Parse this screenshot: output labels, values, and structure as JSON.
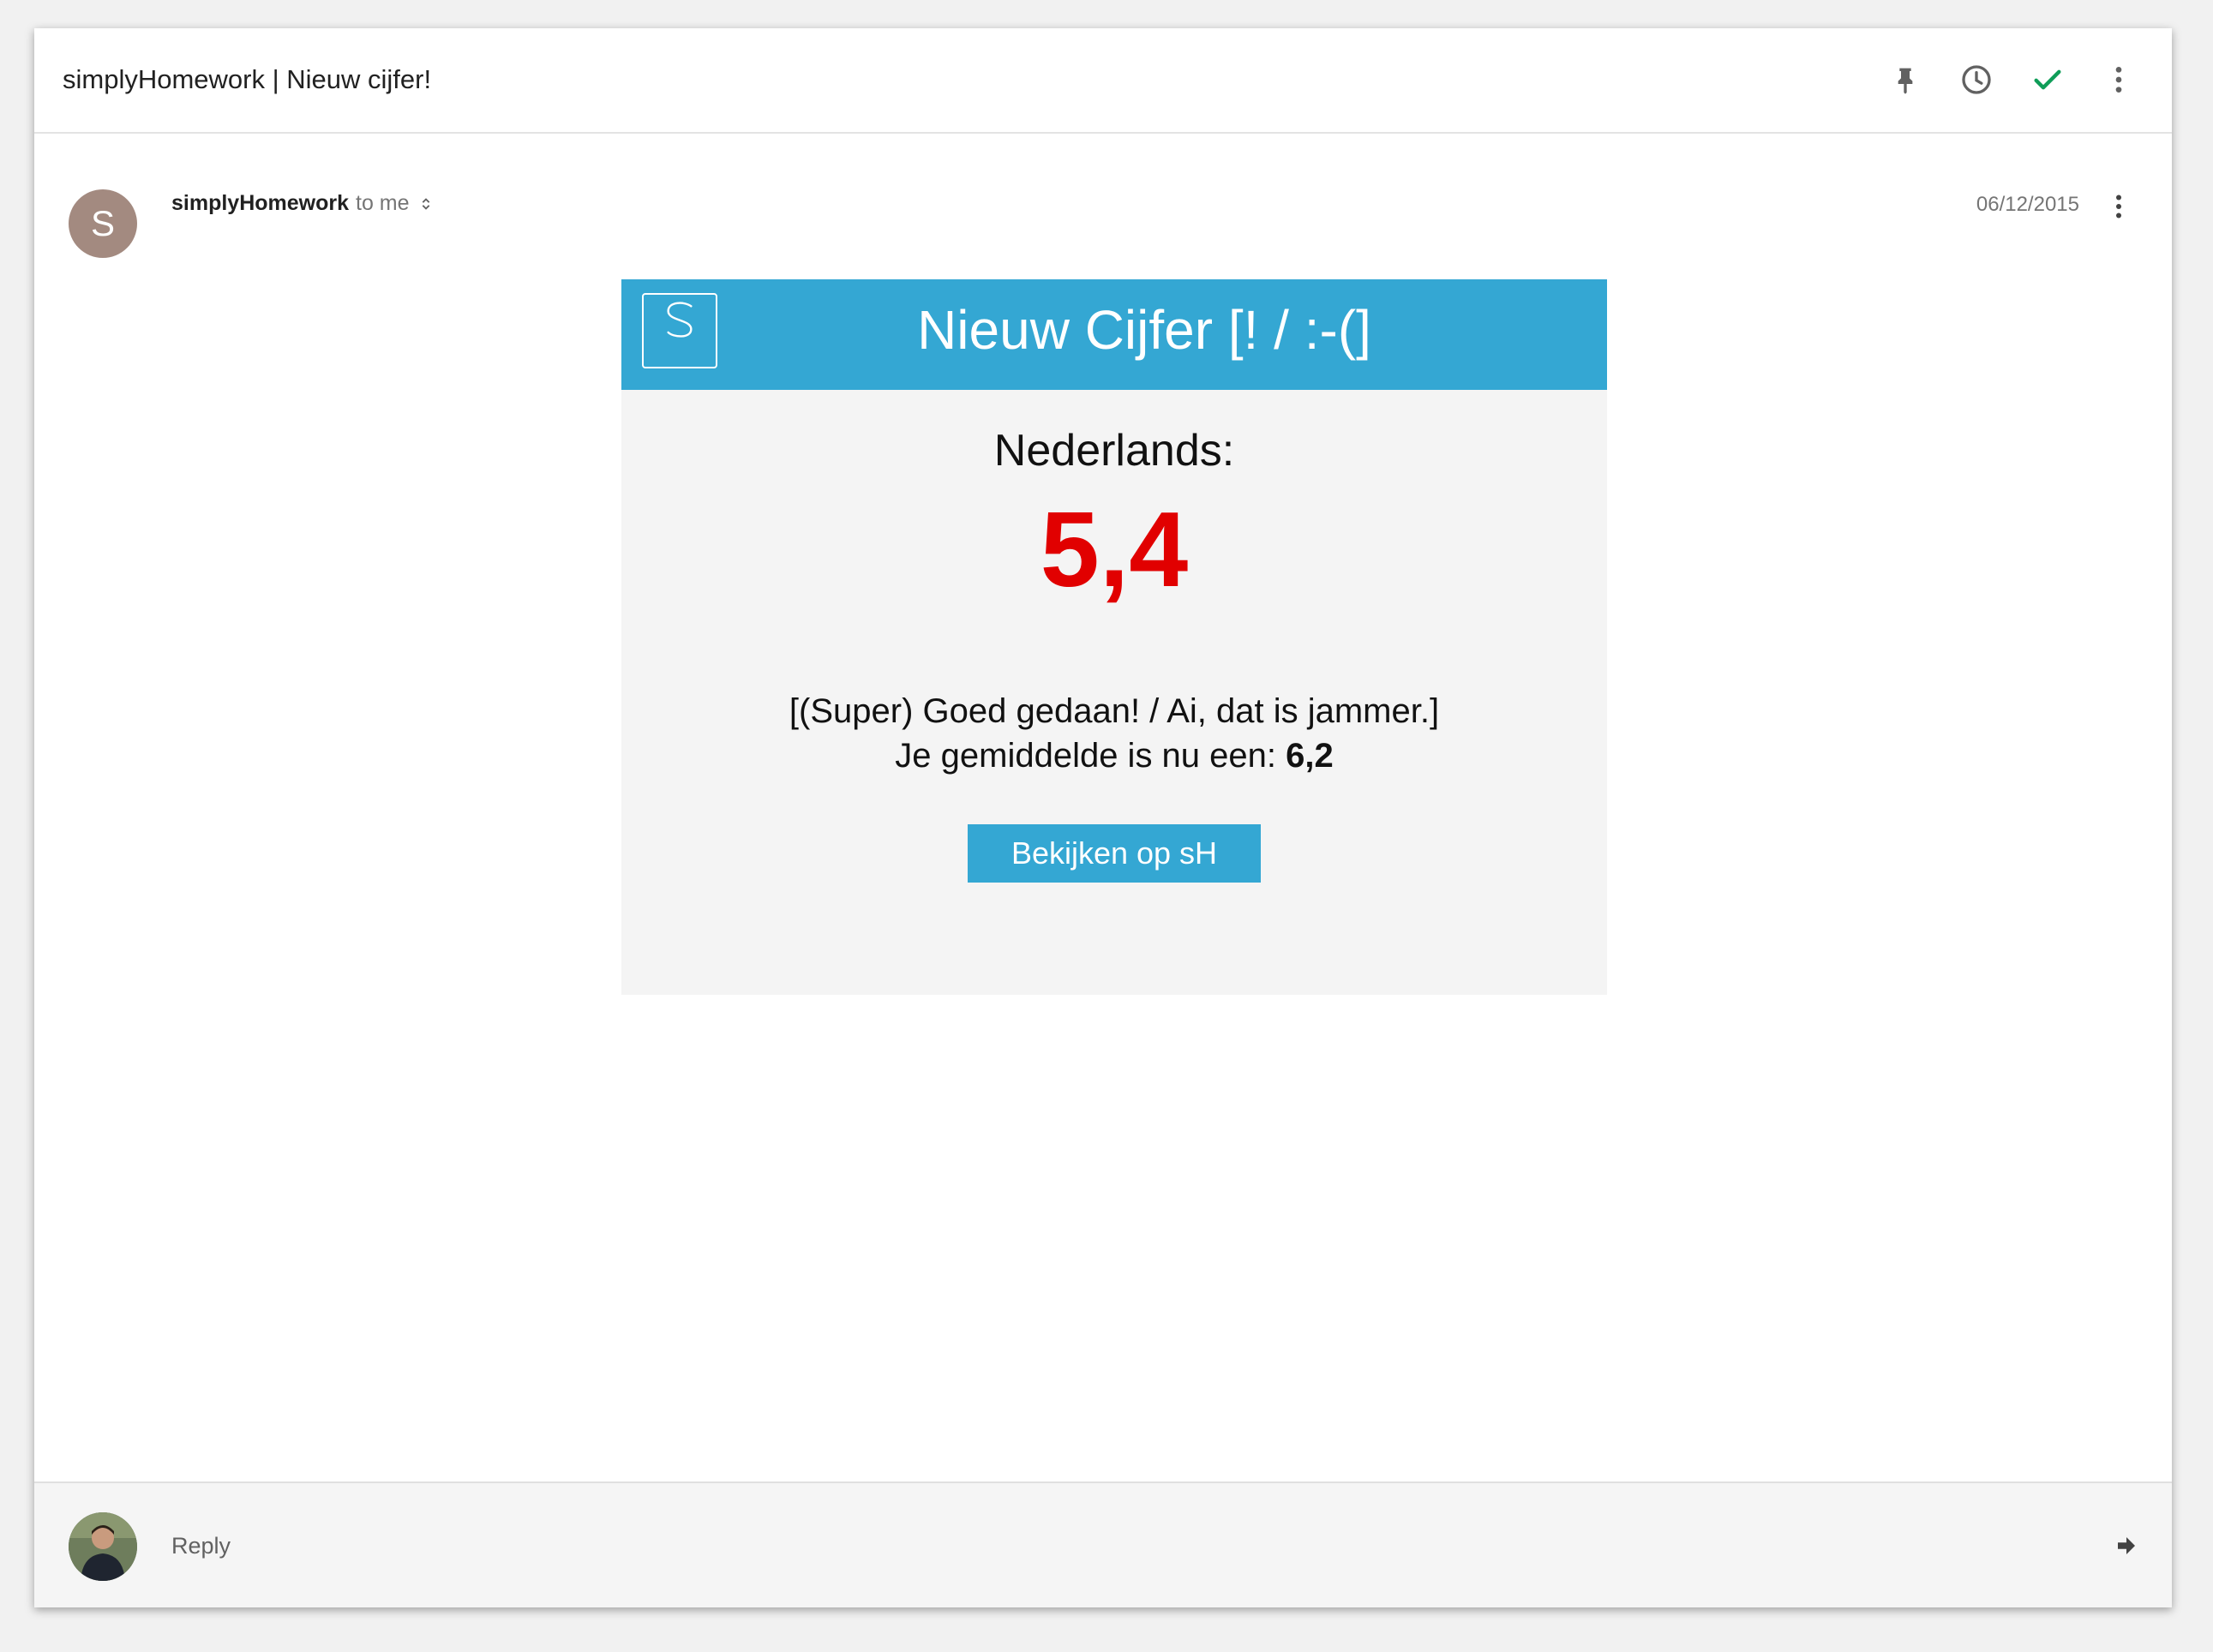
{
  "thread": {
    "subject": "simplyHomework | Nieuw cijfer!",
    "actions": [
      {
        "name": "pin-icon",
        "label": "Pin"
      },
      {
        "name": "clock-icon",
        "label": "Snooze"
      },
      {
        "name": "check-icon",
        "label": "Done",
        "color": "#0f9d58"
      },
      {
        "name": "more-vert-icon",
        "label": "More"
      }
    ]
  },
  "message": {
    "avatar_letter": "S",
    "avatar_color": "#a38a80",
    "sender_name": "simplyHomework",
    "recipient_text": "to me",
    "date": "06/12/2015"
  },
  "email_body": {
    "banner_color": "#34a7d3",
    "title": "Nieuw Cijfer [! / :-(]",
    "subject_label": "Nederlands:",
    "grade": "5,4",
    "grade_color": "#e10000",
    "feedback": "[(Super) Goed gedaan! / Ai, dat is jammer.]",
    "average_prefix": "Je gemiddelde is nu een: ",
    "average_value": "6,2",
    "button_label": "Bekijken op sH"
  },
  "reply": {
    "label": "Reply"
  }
}
